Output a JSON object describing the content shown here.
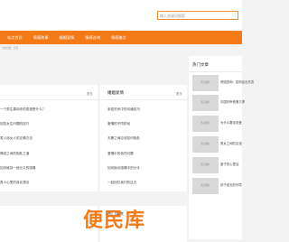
{
  "search": {
    "placeholder": "输入关键词搜索"
  },
  "nav": [
    {
      "label": "站点首页"
    },
    {
      "label": "情感故事"
    },
    {
      "label": "婚姻爱情"
    },
    {
      "label": "情感咨询"
    },
    {
      "label": "情感美文"
    },
    {
      "label": "两性关系"
    }
  ],
  "breadcrumb": "当前位置：首页",
  "left_panel": {
    "more": "更多",
    "items": [
      "一个男生喜欢你的表现是什么？",
      "回答女生问题的技巧",
      "男人追女人的正确方法",
      "情侣之间的相处之道",
      "如何维持一段长久的感情",
      "男人心里的真实想法"
    ]
  },
  "middle_panel": {
    "title": "婚姻爱情",
    "more": "更多",
    "items": [
      "亲密关系中的沟通技巧",
      "爱情的不同阶段",
      "夫妻之间应该如何相处",
      "爱情中的信任问题",
      "如何面对感情中的分手",
      "一起回忆我们的过去"
    ]
  },
  "hot_panel": {
    "title": "热门文章",
    "thumb_label": "暂无图片",
    "items": [
      "情感咨询：如何走出失恋",
      "中国好声音第几季",
      "为什么要谈恋爱",
      "男女之间的友谊",
      "妻子的心里话",
      "孩子成长的环境"
    ]
  },
  "bottom_panel": {
    "title": "热门美文"
  },
  "watermark": "便民库"
}
